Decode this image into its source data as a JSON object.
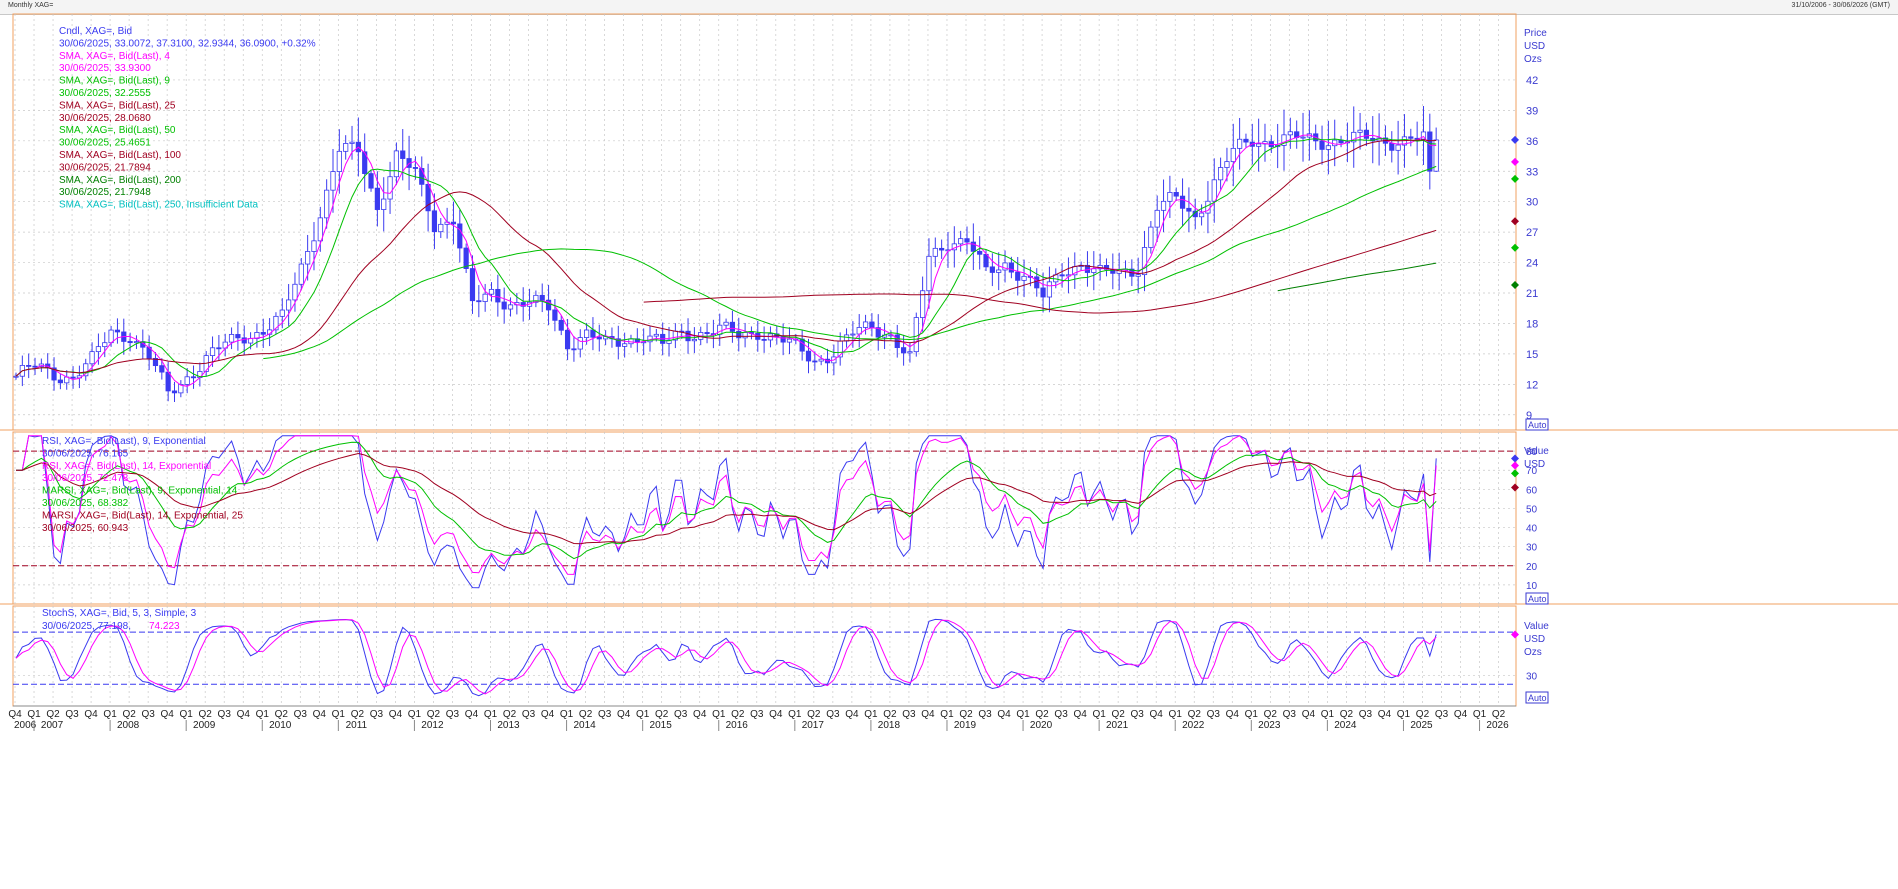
{
  "window": {
    "title": "Monthly XAG=",
    "date_range": "31/10/2006 - 30/06/2026 (GMT)"
  },
  "colors": {
    "candle_up": "#ffffff",
    "candle_down": "#3a3af0",
    "candle_line": "#3a3af0",
    "sma4": "#ff00ff",
    "sma9": "#00c000",
    "sma25": "#a00020",
    "sma50": "#00c000",
    "sma100": "#a00020",
    "sma200": "#008000",
    "sma250": "#00c0c0",
    "rsi9": "#3a3af0",
    "rsi14": "#ff00ff",
    "marsi9": "#00c000",
    "marsi14": "#a00020",
    "stoch_k": "#3a3af0",
    "stoch_d": "#ff00ff",
    "frame": "#f0a060",
    "grid": "#c8c8c8"
  },
  "legend": {
    "price": [
      {
        "label": "Cndl, XAG=, Bid",
        "value": "30/06/2025, 33.0072, 37.3100, 32.9344, 36.0900, +0.32%",
        "color": "#3a3af0"
      },
      {
        "label": "SMA, XAG=, Bid(Last),  4",
        "value": "30/06/2025, 33.9300",
        "color": "#ff00ff"
      },
      {
        "label": "SMA, XAG=, Bid(Last),  9",
        "value": "30/06/2025, 32.2555",
        "color": "#00c000"
      },
      {
        "label": "SMA, XAG=, Bid(Last),  25",
        "value": "30/06/2025, 28.0680",
        "color": "#a00020"
      },
      {
        "label": "SMA, XAG=, Bid(Last),  50",
        "value": "30/06/2025, 25.4651",
        "color": "#00c000"
      },
      {
        "label": "SMA, XAG=, Bid(Last),  100",
        "value": "30/06/2025, 21.7894",
        "color": "#a00020"
      },
      {
        "label": "SMA, XAG=, Bid(Last),  200",
        "value": "30/06/2025, 21.7948",
        "color": "#008000"
      },
      {
        "label": "SMA, XAG=, Bid(Last),  250,  Insufficient Data",
        "value": "",
        "color": "#00c0c0"
      }
    ],
    "rsi": [
      {
        "label": "RSI, XAG=, Bid(Last),  9, Exponential",
        "value": "30/06/2025, 76.165",
        "color": "#3a3af0"
      },
      {
        "label": "RSI, XAG=, Bid(Last),  14, Exponential",
        "value": "30/06/2025, 72.478",
        "color": "#ff00ff"
      },
      {
        "label": "MARSI, XAG=, Bid(Last),  9, Exponential, 14",
        "value": "30/06/2025, 68.382",
        "color": "#00c000"
      },
      {
        "label": "MARSI, XAG=, Bid(Last),  14, Exponential, 25",
        "value": "30/06/2025, 60.943",
        "color": "#a00020"
      }
    ],
    "stoch": [
      {
        "label": "StochS, XAG=, Bid,  5, 3, Simple, 3",
        "value_k": "30/06/2025, 77.198,",
        "value_d": "74.223",
        "color": "#3a3af0"
      }
    ]
  },
  "axes": {
    "price": {
      "header": [
        "Price",
        "USD",
        "Ozs"
      ],
      "ticks": [
        "9",
        "12",
        "15",
        "18",
        "21",
        "24",
        "27",
        "30",
        "33",
        "36",
        "39",
        "42"
      ],
      "min": 7.5,
      "max": 48.5,
      "auto": "Auto"
    },
    "rsi": {
      "header": [
        "Value",
        "USD"
      ],
      "ticks": [
        "10",
        "20",
        "30",
        "40",
        "50",
        "60",
        "70",
        "80"
      ],
      "min": 0,
      "max": 90,
      "auto": "Auto",
      "ref_lines": [
        80,
        20
      ]
    },
    "stoch": {
      "header": [
        "Value",
        "USD",
        "Ozs"
      ],
      "ticks": [
        "30"
      ],
      "min": -5,
      "max": 110,
      "auto": "Auto",
      "ref_lines": [
        80,
        20
      ]
    }
  },
  "time_axis": {
    "quarters": [
      "Q4",
      "Q1",
      "Q2",
      "Q3",
      "Q4",
      "Q1",
      "Q2",
      "Q3",
      "Q4",
      "Q1",
      "Q2",
      "Q3",
      "Q4",
      "Q1",
      "Q2",
      "Q3",
      "Q4",
      "Q1",
      "Q2",
      "Q3",
      "Q4",
      "Q1",
      "Q2",
      "Q3",
      "Q4",
      "Q1",
      "Q2",
      "Q3",
      "Q4",
      "Q1",
      "Q2",
      "Q3",
      "Q4",
      "Q1",
      "Q2",
      "Q3",
      "Q4",
      "Q1",
      "Q2",
      "Q3",
      "Q4",
      "Q1",
      "Q2",
      "Q3",
      "Q4",
      "Q1",
      "Q2",
      "Q3",
      "Q4",
      "Q1",
      "Q2",
      "Q3",
      "Q4",
      "Q1",
      "Q2",
      "Q3",
      "Q4",
      "Q1",
      "Q2",
      "Q3",
      "Q4",
      "Q1",
      "Q2",
      "Q3",
      "Q4",
      "Q1",
      "Q2",
      "Q3",
      "Q4",
      "Q1",
      "Q2",
      "Q3",
      "Q4",
      "Q1",
      "Q2",
      "Q3",
      "Q4",
      "Q1",
      "Q2"
    ],
    "years": [
      "2006",
      "2007",
      "2008",
      "2009",
      "2010",
      "2011",
      "2012",
      "2013",
      "2014",
      "2015",
      "2016",
      "2017",
      "2018",
      "2019",
      "2020",
      "2021",
      "2022",
      "2023",
      "2024",
      "2025",
      "2026"
    ]
  },
  "chart_data": {
    "type": "candlestick",
    "title": "Monthly XAG=",
    "interval": "monthly",
    "x_start": "2006-10",
    "x_end": "2025-06",
    "close_quarterly": [
      12.8,
      13.6,
      13.1,
      12.8,
      14.2,
      17.2,
      17.0,
      14.6,
      11.0,
      12.9,
      14.5,
      15.8,
      16.9,
      17.4,
      18.4,
      23.5,
      29.0,
      35.0,
      34.9,
      29.6,
      34.5,
      32.6,
      27.8,
      28.5,
      19.6,
      21.0,
      20.1,
      19.9,
      19.5,
      16.2,
      16.9,
      15.8,
      16.5,
      16.9,
      15.7,
      17.1,
      17.2,
      17.3,
      16.7,
      17.4,
      16.5,
      15.5,
      14.5,
      15.2,
      16.8,
      17.8,
      17.0,
      14.4,
      24.5,
      26.3,
      26.1,
      22.8,
      24.0,
      22.8,
      20.4,
      23.2,
      24.1,
      22.8,
      22.9,
      23.7,
      29.4,
      30.1,
      28.6,
      32.0,
      34.8,
      36.1
    ],
    "sma_latest": {
      "sma4": 33.93,
      "sma9": 32.2555,
      "sma25": 28.068,
      "sma50": 25.4651,
      "sma100": 21.7894,
      "sma200": 21.7948
    },
    "candle_latest": {
      "date": "30/06/2025",
      "open": 33.0072,
      "high": 37.31,
      "low": 32.9344,
      "close": 36.09,
      "change_pct": 0.32
    },
    "rsi_latest": {
      "rsi9": 76.165,
      "rsi14": 72.478,
      "marsi9": 68.382,
      "marsi14": 60.943
    },
    "stoch_latest": {
      "k": 77.198,
      "d": 74.223
    }
  }
}
